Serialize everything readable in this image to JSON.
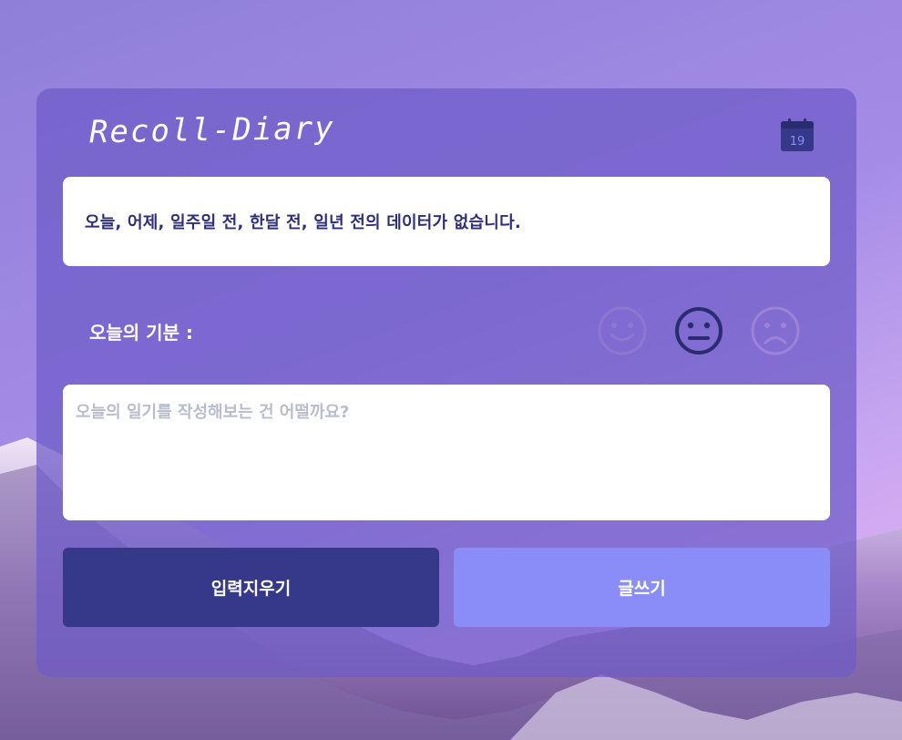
{
  "app": {
    "title": "Recoll-Diary",
    "calendar_day": "19"
  },
  "info": {
    "message": "오늘, 어제, 일주일 전, 한달 전, 일년 전의 데이터가 없습니다."
  },
  "mood": {
    "label": "오늘의 기분 :",
    "options": [
      "happy",
      "neutral",
      "sad"
    ],
    "selected": "neutral"
  },
  "editor": {
    "value": "",
    "placeholder": "오늘의 일기를 작성해보는 건 어떨까요?"
  },
  "actions": {
    "clear_label": "입력지우기",
    "write_label": "글쓰기"
  },
  "colors": {
    "accent_dark": "#363889",
    "accent_light": "#8a8df7",
    "text_dark": "#2e2f78"
  },
  "icons": {
    "calendar": "calendar-icon",
    "happy": "smile-face-icon",
    "neutral": "neutral-face-icon",
    "sad": "sad-face-icon"
  }
}
